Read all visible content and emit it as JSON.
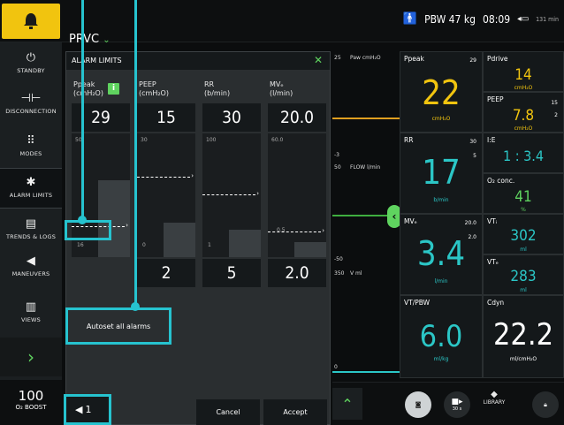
{
  "topbar": {
    "pbw": "PBW 47 kg",
    "time": "08:09",
    "battery": "131 min"
  },
  "sidebar": {
    "items": [
      {
        "label": "STANDBY",
        "icon": "power-icon"
      },
      {
        "label": "DISCONNECTION",
        "icon": "disconnect-icon"
      },
      {
        "label": "MODES",
        "icon": "grid-icon"
      },
      {
        "label": "ALARM LIMITS",
        "icon": "bell-limits-icon"
      },
      {
        "label": "TRENDS & LOGS",
        "icon": "trends-icon"
      },
      {
        "label": "MANEUVERS",
        "icon": "maneuver-icon"
      },
      {
        "label": "VIEWS",
        "icon": "views-icon"
      }
    ],
    "boost_value": "100",
    "boost_label": "O₂ BOOST"
  },
  "mode": {
    "name": "PRVC"
  },
  "panel": {
    "title": "ALARM LIMITS",
    "columns": [
      {
        "name": "Ppeak",
        "unit": "(cmH₂O)",
        "upper": "29",
        "lower": "",
        "scale_top": "50",
        "scale_bottom": "16",
        "fill": 0.62,
        "marker": 0.78
      },
      {
        "name": "PEEP",
        "unit": "(cmH₂O)",
        "upper": "15",
        "lower": "2",
        "scale_top": "30",
        "scale_bottom": "0",
        "fill": 0.28,
        "marker": 0.38
      },
      {
        "name": "RR",
        "unit": "(b/min)",
        "upper": "30",
        "lower": "5",
        "scale_top": "100",
        "scale_bottom": "1",
        "fill": 0.22,
        "marker": 0.52
      },
      {
        "name": "MVₑ",
        "unit": "(l/min)",
        "upper": "20.0",
        "lower": "2.0",
        "scale_top": "60.0",
        "scale_bottom": "",
        "fill": 0.12,
        "marker": 0.82
      }
    ],
    "marker_value": "0.5",
    "autoset_label": "Autoset all alarms",
    "cancel_label": "Cancel",
    "accept_label": "Accept",
    "volume_level": "1"
  },
  "waves": {
    "paw": {
      "scale_top": "25",
      "label": "Paw cmH₂O",
      "scale_bottom": "-3"
    },
    "flow": {
      "scale_top": "50",
      "label": "FLOW l/min",
      "scale_bottom": "-50"
    },
    "vol": {
      "scale_top": "350",
      "label": "V ml",
      "scale_bottom": "0"
    }
  },
  "metrics": {
    "ppeak": {
      "name": "Ppeak",
      "value": "22",
      "unit": "cmH₂O",
      "limit": "29"
    },
    "pdrive": {
      "name": "Pdrive",
      "value": "14",
      "unit": "cmH₂O"
    },
    "peep": {
      "name": "PEEP",
      "value": "7.8",
      "unit": "cmH₂O",
      "lim_hi": "15",
      "lim_lo": "2"
    },
    "rr": {
      "name": "RR",
      "value": "17",
      "unit": "b/min",
      "lim_hi": "30",
      "lim_lo": "5"
    },
    "ie": {
      "name": "I:E",
      "value": "1 : 3.4"
    },
    "o2": {
      "name": "O₂ conc.",
      "value": "41",
      "unit": "%"
    },
    "mve": {
      "name": "MVₑ",
      "value": "3.4",
      "unit": "l/min",
      "lim_hi": "20.0",
      "lim_lo": "2.0"
    },
    "vti": {
      "name": "VTᵢ",
      "value": "302",
      "unit": "ml"
    },
    "vte": {
      "name": "VTₑ",
      "value": "283",
      "unit": "ml"
    },
    "vtpbw": {
      "name": "VT/PBW",
      "value": "6.0",
      "unit": "ml/kg"
    },
    "cdyn": {
      "name": "Cdyn",
      "value": "22.2",
      "unit": "ml/cmH₂O"
    }
  },
  "bottombar": {
    "timer_label": "30 s",
    "library_label": "LIBRARY"
  },
  "colors": {
    "accent_green": "#5fd35f",
    "metric_yellow": "#f1c40f",
    "metric_teal": "#2bc6c6",
    "highlight": "#26c3cf"
  }
}
